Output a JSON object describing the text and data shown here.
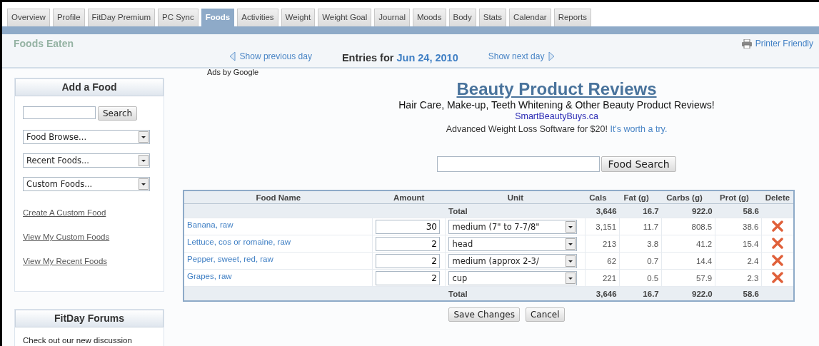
{
  "tabs": [
    {
      "label": "Overview",
      "selected": false
    },
    {
      "label": "Profile",
      "selected": false
    },
    {
      "label": "FitDay Premium",
      "selected": false
    },
    {
      "label": "PC Sync",
      "selected": false
    },
    {
      "label": "Foods",
      "selected": true
    },
    {
      "label": "Activities",
      "selected": false
    },
    {
      "label": "Weight",
      "selected": false
    },
    {
      "label": "Weight Goal",
      "selected": false
    },
    {
      "label": "Journal",
      "selected": false
    },
    {
      "label": "Moods",
      "selected": false
    },
    {
      "label": "Body",
      "selected": false
    },
    {
      "label": "Stats",
      "selected": false
    },
    {
      "label": "Calendar",
      "selected": false
    },
    {
      "label": "Reports",
      "selected": false
    }
  ],
  "header": {
    "title": "Foods Eaten",
    "previous": "Show previous day",
    "entries_label": "Entries for",
    "date": "Jun 24, 2010",
    "next": "Show next day",
    "printer": "Printer Friendly"
  },
  "sidebar": {
    "add_food": {
      "title": "Add a Food",
      "search_button": "Search",
      "dropdowns": [
        "Food Browse...",
        "Recent Foods...",
        "Custom Foods..."
      ],
      "links": [
        "Create A Custom Food",
        "View My Custom Foods",
        "View My Recent Foods"
      ]
    },
    "forums": {
      "title": "FitDay Forums",
      "text": "Check out our new discussion"
    }
  },
  "ad": {
    "label": "Ads by Google",
    "headline": "Beauty Product Reviews",
    "description": "Hair Care, Make-up, Teeth Whitening & Other Beauty Product Reviews!",
    "url": "SmartBeautyBuys.ca",
    "promo": "Advanced Weight Loss Software for $20!",
    "promo_link": "It's worth a try."
  },
  "food_search": {
    "button": "Food Search"
  },
  "table": {
    "columns": [
      "Food Name",
      "Amount",
      "Unit",
      "Cals",
      "Fat (g)",
      "Carbs (g)",
      "Prot (g)",
      "Delete"
    ],
    "total_top": {
      "label": "Total",
      "cals": "3,646",
      "fat": "16.7",
      "carbs": "922.0",
      "prot": "58.6"
    },
    "rows": [
      {
        "name": "Banana, raw",
        "amount": "30",
        "unit": "medium (7\" to 7-7/8\"",
        "cals": "3,151",
        "fat": "11.7",
        "carbs": "808.5",
        "prot": "38.6"
      },
      {
        "name": "Lettuce, cos or romaine, raw",
        "amount": "2",
        "unit": "head",
        "cals": "213",
        "fat": "3.8",
        "carbs": "41.2",
        "prot": "15.4"
      },
      {
        "name": "Pepper, sweet, red, raw",
        "amount": "2",
        "unit": "medium (approx 2-3/",
        "cals": "62",
        "fat": "0.7",
        "carbs": "14.4",
        "prot": "2.4"
      },
      {
        "name": "Grapes, raw",
        "amount": "2",
        "unit": "cup",
        "cals": "221",
        "fat": "0.5",
        "carbs": "57.9",
        "prot": "2.3"
      }
    ],
    "total_bottom": {
      "label": "Total",
      "cals": "3,646",
      "fat": "16.7",
      "carbs": "922.0",
      "prot": "58.6"
    }
  },
  "buttons": [
    "Save Changes",
    "Cancel"
  ]
}
